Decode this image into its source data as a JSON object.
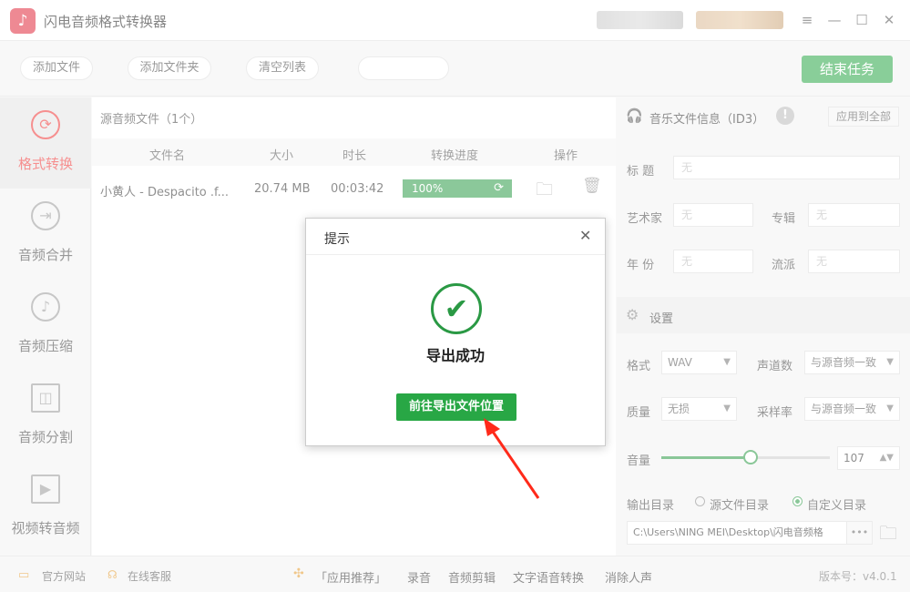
{
  "titlebar": {
    "title": "闪电音频格式转换器",
    "logo_icon": "music-note-icon",
    "controls": [
      "≡",
      "—",
      "☐",
      "✕"
    ]
  },
  "toolbar": {
    "add_file": "添加文件",
    "add_folder": "添加文件夹",
    "clear_list": "清空列表",
    "end_task": "结束任务"
  },
  "sidebar": {
    "items": [
      {
        "label": "格式转换",
        "icon": "refresh-icon",
        "active": true
      },
      {
        "label": "音频合并",
        "icon": "merge-icon",
        "active": false
      },
      {
        "label": "音频压缩",
        "icon": "music-disc-icon",
        "active": false
      },
      {
        "label": "音频分割",
        "icon": "split-icon",
        "active": false
      },
      {
        "label": "视频转音频",
        "icon": "video-icon",
        "active": false
      }
    ]
  },
  "file_list": {
    "title": "源音频文件（1个）",
    "columns": [
      "文件名",
      "大小",
      "时长",
      "转换进度",
      "操作"
    ],
    "rows": [
      {
        "name": "小黄人 - Despacito .f...",
        "size": "20.74 MB",
        "duration": "00:03:42",
        "progress": "100%"
      }
    ]
  },
  "id3": {
    "title": "音乐文件信息（ID3）",
    "apply_all": "应用到全部",
    "title_label": "标 题",
    "artist_label": "艺术家",
    "album_label": "专辑",
    "year_label": "年 份",
    "genre_label": "流派",
    "empty_value": "无"
  },
  "settings": {
    "title": "设置",
    "format_label": "格式",
    "format_value": "WAV",
    "channels_label": "声道数",
    "channels_value": "与源音频一致",
    "quality_label": "质量",
    "quality_value": "无损",
    "sample_label": "采样率",
    "sample_value": "与源音频一致",
    "volume_label": "音量",
    "volume_value": "107",
    "output_label": "输出目录",
    "opt_source": "源文件目录",
    "opt_custom": "自定义目录",
    "output_path": "C:\\Users\\NING MEI\\Desktop\\闪电音频格",
    "more": "•••"
  },
  "bottom": {
    "official": "官方网站",
    "service": "在线客服",
    "recommend": "「应用推荐」",
    "record": "录音",
    "edit": "音频剪辑",
    "tts": "文字语音转换",
    "vocal": "消除人声",
    "version": "版本号：v4.0.1"
  },
  "dialog": {
    "title": "提示",
    "close": "✕",
    "message": "导出成功",
    "button": "前往导出文件位置"
  },
  "colors": {
    "accent": "#28a745",
    "active": "#e33333"
  }
}
